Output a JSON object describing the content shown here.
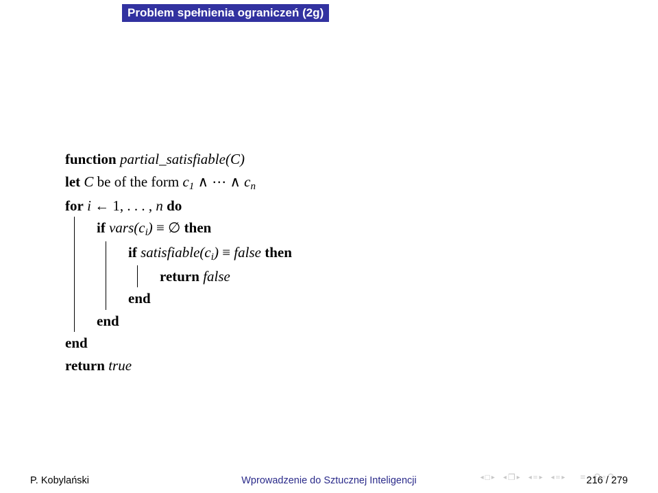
{
  "title": "Problem spełnienia ograniczeń (2g)",
  "algo": {
    "l1_kw1": "function",
    "l1_name": "partial_satisfiable",
    "l1_paren_open": "(",
    "l1_arg": "C",
    "l1_paren_close": ")",
    "l2_kw": "let",
    "l2_var": "C",
    "l2_be": "be of the form",
    "l2_c": "c",
    "l2_sub1": "1",
    "l2_and": " ∧ ⋯ ∧ ",
    "l2_subn": "n",
    "l3_kw": "for",
    "l3_i": "i",
    "l3_arrow": " ← ",
    "l3_range": "1, . . . , ",
    "l3_n": "n",
    "l3_do": "do",
    "l4_kw": "if",
    "l4_vars": "vars",
    "l4_open": "(",
    "l4_c": "c",
    "l4_sub": "i",
    "l4_close": ")",
    "l4_eq": " ≡ ∅ ",
    "l4_then": "then",
    "l5_kw": "if",
    "l5_sat": "satisfiable",
    "l5_open": "(",
    "l5_c": "c",
    "l5_sub": "i",
    "l5_close": ")",
    "l5_eq": " ≡ ",
    "l5_false": "false",
    "l5_then": "then",
    "l6_kw": "return",
    "l6_val": "false",
    "l7_end": "end",
    "l8_end": "end",
    "l9_end": "end",
    "l10_kw": "return",
    "l10_val": "true"
  },
  "footer": {
    "author": "P. Kobylański",
    "center": "Wprowadzenie do Sztucznej Inteligencji",
    "pages": "216 / 279"
  },
  "nav": {
    "first": "◂",
    "frame": "□",
    "doc": "❐",
    "bars": "≡",
    "undo": "↶",
    "redo": "↷"
  }
}
